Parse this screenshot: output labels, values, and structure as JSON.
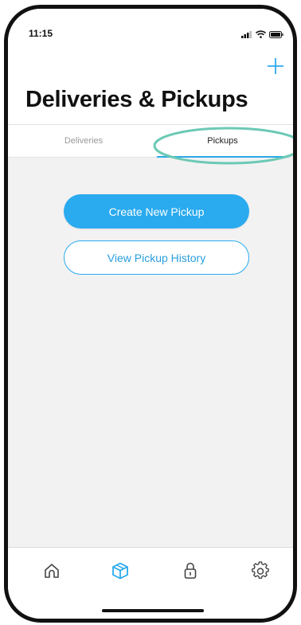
{
  "status_bar": {
    "time": "11:15",
    "icons": [
      "signal-icon",
      "wifi-icon",
      "battery-icon"
    ]
  },
  "header": {
    "add_icon": "plus-icon",
    "title": "Deliveries & Pickups"
  },
  "tabs": [
    {
      "label": "Deliveries",
      "selected": false
    },
    {
      "label": "Pickups",
      "selected": true
    }
  ],
  "actions": {
    "create_label": "Create New Pickup",
    "history_label": "View Pickup History"
  },
  "bottom_nav": {
    "items": [
      {
        "icon": "home-icon",
        "active": false
      },
      {
        "icon": "package-icon",
        "active": true
      },
      {
        "icon": "lock-icon",
        "active": false
      },
      {
        "icon": "gear-icon",
        "active": false
      }
    ]
  },
  "colors": {
    "accent": "#2aaaef",
    "annotation": "#6cc9b5",
    "inactive_icon": "#444444",
    "background": "#f2f2f2"
  }
}
